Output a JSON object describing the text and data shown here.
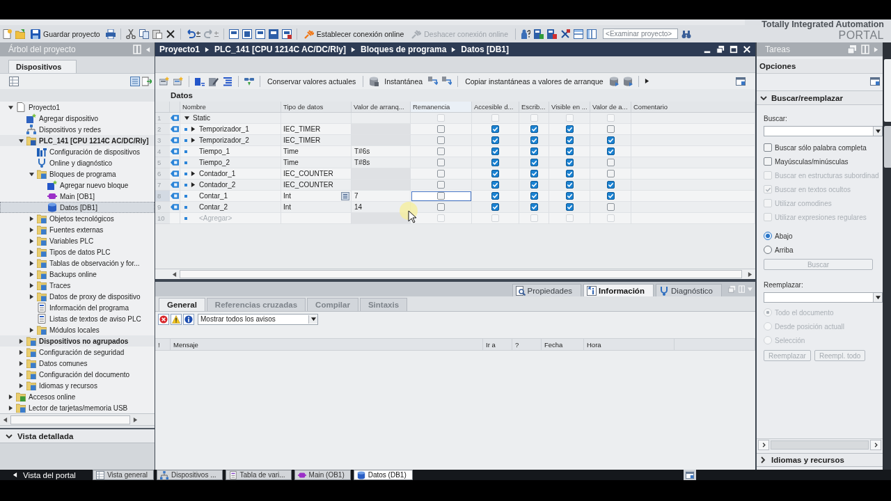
{
  "toolbar": {
    "buttons": [
      {
        "label": "Guardar proyecto",
        "kind": "save",
        "disabled": false
      },
      {
        "label": "Establecer conexión online",
        "kind": "connect",
        "disabled": false
      },
      {
        "label": "Deshacer conexión online",
        "kind": "disconnect",
        "disabled": true
      }
    ],
    "search": {
      "placeholder": "<Examinar proyecto>"
    }
  },
  "brand": {
    "line_1": "Totally Integrated Automation",
    "line_2": "PORTAL"
  },
  "project_tree": {
    "title": "Árbol del proyecto",
    "tabs": [
      {
        "label": "Dispositivos",
        "selected": true
      }
    ],
    "items": [
      {
        "label": "Proyecto1",
        "kind": "project",
        "expanded": true,
        "selected": false,
        "children": [
          {
            "label": "Agregar dispositivo",
            "kind": "add-device",
            "selected": false
          },
          {
            "label": "Dispositivos y redes",
            "kind": "network",
            "selected": false
          },
          {
            "label": "PLC_141 [CPU 1214C AC/DC/Rly]",
            "kind": "plc",
            "bold": true,
            "expanded": true,
            "selected": false,
            "children": [
              {
                "label": "Configuración de dispositivos",
                "kind": "config",
                "selected": false
              },
              {
                "label": "Online y diagnóstico",
                "kind": "diagnostics",
                "selected": false
              },
              {
                "label": "Bloques de programa",
                "kind": "folder",
                "expanded": true,
                "selected": false,
                "children": [
                  {
                    "label": "Agregar nuevo bloque",
                    "kind": "add-block",
                    "selected": false
                  },
                  {
                    "label": "Main [OB1]",
                    "kind": "ob",
                    "selected": false
                  },
                  {
                    "label": "Datos [DB1]",
                    "kind": "db",
                    "selected": true
                  }
                ]
              },
              {
                "label": "Objetos tecnológicos",
                "kind": "folder",
                "expanded": false,
                "selected": false
              },
              {
                "label": "Fuentes externas",
                "kind": "folder",
                "expanded": false,
                "selected": false
              },
              {
                "label": "Variables PLC",
                "kind": "folder",
                "expanded": false,
                "selected": false
              },
              {
                "label": "Tipos de datos PLC",
                "kind": "folder",
                "expanded": false,
                "selected": false
              },
              {
                "label": "Tablas de observación y for...",
                "kind": "folder",
                "expanded": false,
                "selected": false
              },
              {
                "label": "Backups online",
                "kind": "folder",
                "expanded": false,
                "selected": false
              },
              {
                "label": "Traces",
                "kind": "folder",
                "expanded": false,
                "selected": false
              },
              {
                "label": "Datos de proxy de dispositivo",
                "kind": "folder",
                "expanded": false,
                "selected": false
              },
              {
                "label": "Información del programa",
                "kind": "info",
                "selected": false
              },
              {
                "label": "Listas de textos de aviso PLC",
                "kind": "list",
                "selected": false
              },
              {
                "label": "Módulos locales",
                "kind": "folder",
                "expanded": false,
                "selected": false
              }
            ]
          },
          {
            "label": "Dispositivos no agrupados",
            "kind": "folder",
            "bold": true,
            "expanded": false,
            "selected": false
          },
          {
            "label": "Configuración de seguridad",
            "kind": "folder",
            "expanded": false,
            "selected": false
          },
          {
            "label": "Datos comunes",
            "kind": "folder",
            "expanded": false,
            "selected": false
          },
          {
            "label": "Configuración del documento",
            "kind": "folder",
            "expanded": false,
            "selected": false
          },
          {
            "label": "Idiomas y recursos",
            "kind": "folder",
            "expanded": false,
            "selected": false
          }
        ]
      },
      {
        "label": "Accesos online",
        "kind": "online",
        "expanded": false,
        "selected": false
      },
      {
        "label": "Lector de tarjetas/memoria USB",
        "kind": "reader",
        "expanded": false,
        "selected": false
      }
    ]
  },
  "detail_view": {
    "title": "Vista detallada",
    "expanded": true
  },
  "editor": {
    "breadcrumb": [
      "Proyecto1",
      "PLC_141 [CPU 1214C AC/DC/Rly]",
      "Bloques de programa",
      "Datos [DB1]"
    ],
    "toolbar": [
      "Conservar valores actuales",
      "Instantánea",
      "Copiar instantáneas a valores de arranque"
    ],
    "table": {
      "title": "Datos",
      "columns": [
        "Nombre",
        "Tipo de datos",
        "Valor de arranq...",
        "Remanencia",
        "Accesible d...",
        "Escrib...",
        "Visible en ...",
        "Valor de a...",
        "Comentario"
      ],
      "rows": [
        {
          "number": "1",
          "kind": "section",
          "name": "Static",
          "expanded": true,
          "selected": false,
          "checks": [
            false,
            false,
            false,
            false,
            false
          ]
        },
        {
          "number": "2",
          "kind": "struct",
          "name": "Temporizador_1",
          "type": "IEC_TIMER",
          "expanded": false,
          "selected": false,
          "checks": [
            false,
            true,
            true,
            true,
            false
          ]
        },
        {
          "number": "3",
          "kind": "struct",
          "name": "Temporizador_2",
          "type": "IEC_TIMER",
          "expanded": false,
          "selected": false,
          "checks": [
            false,
            true,
            true,
            true,
            true
          ]
        },
        {
          "number": "4",
          "kind": "value",
          "name": "Tiempo_1",
          "type": "Time",
          "start_value": "T#6s",
          "selected": false,
          "checks": [
            false,
            true,
            true,
            true,
            true
          ]
        },
        {
          "number": "5",
          "kind": "value",
          "name": "Tiempo_2",
          "type": "Time",
          "start_value": "T#8s",
          "selected": false,
          "checks": [
            false,
            true,
            true,
            true,
            false
          ]
        },
        {
          "number": "6",
          "kind": "struct",
          "name": "Contador_1",
          "type": "IEC_COUNTER",
          "expanded": false,
          "selected": false,
          "checks": [
            false,
            true,
            true,
            true,
            false
          ]
        },
        {
          "number": "7",
          "kind": "struct",
          "name": "Contador_2",
          "type": "IEC_COUNTER",
          "expanded": false,
          "selected": false,
          "checks": [
            false,
            true,
            true,
            true,
            true
          ]
        },
        {
          "number": "8",
          "kind": "value",
          "name": "Contar_1",
          "type": "Int",
          "start_value": "7",
          "selected": true,
          "checks": [
            false,
            true,
            true,
            true,
            true
          ]
        },
        {
          "number": "9",
          "kind": "value",
          "name": "Contar_2",
          "type": "Int",
          "start_value": "14",
          "selected": false,
          "checks": [
            false,
            true,
            true,
            true,
            false
          ]
        },
        {
          "number": "10",
          "kind": "add",
          "name": "<Agregar>",
          "selected": false,
          "checks": [
            false,
            false,
            false,
            false,
            false
          ]
        }
      ]
    }
  },
  "inspector": {
    "tabs": [
      {
        "label": "Propiedades",
        "kind": "properties",
        "selected": false
      },
      {
        "label": "Información",
        "kind": "info",
        "selected": true
      },
      {
        "label": "Diagnóstico",
        "kind": "diagnostics",
        "selected": false
      }
    ],
    "subtabs": [
      {
        "label": "General",
        "selected": true
      },
      {
        "label": "Referencias cruzadas",
        "selected": false
      },
      {
        "label": "Compilar",
        "selected": false
      },
      {
        "label": "Sintaxis",
        "selected": false
      }
    ],
    "filter": {
      "value": "Mostrar todos los avisos"
    },
    "columns": [
      "!",
      "Mensaje",
      "Ir a",
      "?",
      "Fecha",
      "Hora"
    ]
  },
  "task_panel": {
    "title": "Tareas",
    "section": "Opciones",
    "find_replace": {
      "title": "Buscar/reemplazar",
      "expanded": true,
      "find_label": "Buscar:",
      "options": [
        {
          "label": "Buscar sólo palabra completa",
          "checked": false,
          "disabled": false
        },
        {
          "label": "Mayúsculas/minúsculas",
          "checked": false,
          "disabled": false
        },
        {
          "label": "Buscar en estructuras subordinad",
          "checked": false,
          "disabled": true
        },
        {
          "label": "Buscar en textos ocultos",
          "checked": true,
          "disabled": true
        },
        {
          "label": "Utilizar comodines",
          "checked": false,
          "disabled": true
        },
        {
          "label": "Utilizar expresiones regulares",
          "checked": false,
          "disabled": true
        }
      ],
      "direction": [
        {
          "label": "Abajo",
          "selected": true,
          "disabled": false
        },
        {
          "label": "Arriba",
          "selected": false,
          "disabled": false
        }
      ],
      "find_button": {
        "label": "Buscar",
        "disabled": true
      },
      "replace_label": "Reemplazar:",
      "scope": [
        {
          "label": "Todo el documento",
          "selected": true,
          "disabled": true
        },
        {
          "label": "Desde posición actuall",
          "selected": false,
          "disabled": true
        },
        {
          "label": "Selección",
          "selected": false,
          "disabled": true
        }
      ],
      "buttons": [
        {
          "label": "Reemplazar",
          "disabled": true
        },
        {
          "label": "Reempl. todo",
          "disabled": true
        }
      ]
    },
    "next_section": {
      "title": "Idiomas y recursos",
      "expanded": false
    }
  },
  "taskbar": {
    "portal_view": "Vista del portal",
    "tabs": [
      {
        "label": "Vista general",
        "kind": "overview",
        "selected": false
      },
      {
        "label": "Dispositivos ...",
        "kind": "devices",
        "selected": false
      },
      {
        "label": "Tabla de vari...",
        "kind": "tags",
        "selected": false
      },
      {
        "label": "Main (OB1)",
        "kind": "ob",
        "selected": false
      },
      {
        "label": "Datos (DB1)",
        "kind": "db",
        "selected": true
      }
    ]
  }
}
